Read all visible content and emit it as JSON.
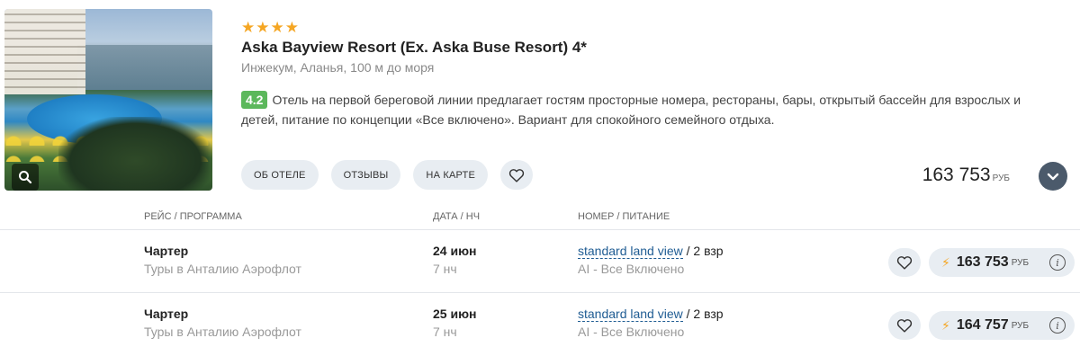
{
  "hotel": {
    "stars": "★★★★",
    "name": "Aska Bayview Resort (Ex. Aska Buse Resort) 4*",
    "location": "Инжекум, Аланья, 100 м до моря",
    "rating": "4.2",
    "description": "Отель на первой береговой линии предлагает гостям просторные номера, рестораны, бары, открытый бассейн для взрослых и детей, питание по концепции «Все включено». Вариант для спокойного семейного отдыха.",
    "price": "163 753",
    "currency": "РУБ"
  },
  "actions": {
    "about": "ОБ ОТЕЛЕ",
    "reviews": "ОТЗЫВЫ",
    "map": "НА КАРТЕ"
  },
  "table": {
    "headers": {
      "flight": "РЕЙС / ПРОГРАММА",
      "date": "ДАТА / НЧ",
      "room": "НОМЕР / ПИТАНИЕ"
    },
    "rows": [
      {
        "flight": "Чартер",
        "program": "Туры в Анталию Аэрофлот",
        "date": "24 июн",
        "nights": "7 нч",
        "room": "standard land view",
        "guests": " / 2 взр",
        "meal": "AI - Все Включено",
        "price": "163 753",
        "currency": "РУБ"
      },
      {
        "flight": "Чартер",
        "program": "Туры в Анталию Аэрофлот",
        "date": "25 июн",
        "nights": "7 нч",
        "room": "standard land view",
        "guests": " / 2 взр",
        "meal": "AI - Все Включено",
        "price": "164 757",
        "currency": "РУБ"
      }
    ]
  },
  "colors": {
    "accent_star": "#f5a623",
    "rating_green": "#5cb85c",
    "link_blue": "#1f5c93",
    "pill_bg": "#e8edf2",
    "expand_bg": "#4b5a6b"
  },
  "icons": {
    "zoom": "search-icon",
    "favorite": "heart-icon",
    "expand": "chevron-down-icon",
    "bolt": "lightning-icon",
    "info": "info-icon"
  }
}
